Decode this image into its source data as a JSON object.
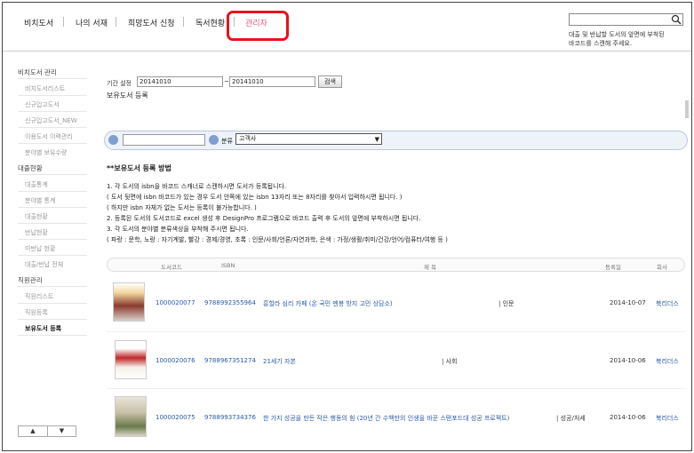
{
  "nav": {
    "items": [
      "비치도서",
      "나의 서재",
      "희망도서 신청",
      "독서현황",
      "관리자"
    ]
  },
  "search": {
    "placeholder": "",
    "help_line1": "대출 및 반납할 도서의 앞면에 부착된",
    "help_line2": "바코드를 스캔해 주세요."
  },
  "sidebar": {
    "group1": "비치도서 관리",
    "group1_items": [
      "비치도서리스트",
      "신규입고도서",
      "신규입고도서_NEW",
      "이용도서 이력관리",
      "분야별 보유수량"
    ],
    "group2": "대출현황",
    "group2_items": [
      "대출통계",
      "분야별 통계",
      "대출현황",
      "반납현황",
      "미반납 현황",
      "대출/반납 전체"
    ],
    "group3": "직원관리",
    "group3_items": [
      "직원리스트",
      "직원등록"
    ],
    "active_item": "보유도서 등록",
    "up": "▲",
    "down": "▼"
  },
  "period": {
    "label": "기간 설정",
    "from": "20141010",
    "to": "20141010",
    "tilde": "~",
    "button": "검색"
  },
  "section_title": "보유도서 등록",
  "register": {
    "barcode_value": "",
    "genre_label": "분류",
    "genre_selected": "고객사"
  },
  "guide": {
    "title": "**보유도서 등록 방법",
    "lines": [
      "1. 각 도서의 isbn을 바코드 스캐너로 스캔하시면 도서가 등록됩니다.",
      "( 도서 뒷면에 isbn 바코드가 있는 경우 도서 안쪽에 있는 isbn 13자리 또는 8자리를 찾아서 입력하시면 됩니다. )",
      "( 하지만 isbn 자체가 없는 도서는 등록이 불가능합니다. )",
      "2. 등록된 도서의 도서코드로 excel 생성 후 DesignPro 프로그램으로 바코드 출력 후 도서의 앞면에 부착하시면 됩니다.",
      "3. 각 도서의 분야별 분류색상을 부착해 주시면 됩니다.",
      "( 파랑 : 문학, 노랑 : 자기계발, 빨강 : 경제/경영, 초록 : 인문/사회/언론/자연과학, 은색 : 가정/생활/취미/건강/언어/컴퓨터/여행 등 )"
    ]
  },
  "table": {
    "headers": [
      "도서코드",
      "ISBN",
      "제 목",
      "등록일",
      "회사"
    ],
    "rows": [
      {
        "code": "1000020077",
        "isbn": "9788992355964",
        "title": "흥할라 심리 카페 (온 국민 멘붕 방지 고민 상담소)",
        "category": "| 인문",
        "date": "2014-10-07",
        "company": "북리더스"
      },
      {
        "code": "1000020076",
        "isbn": "9788967351274",
        "title": "21세기 자본",
        "category": "| 사회",
        "date": "2014-10-06",
        "company": "북리더스"
      },
      {
        "code": "1000020075",
        "isbn": "9788993734376",
        "title": "한 가지 성공을 만든 작은 행동의 힘 (20년 간 수백만의 인생을 바꾼 스탠포드대 성공 프로젝트)",
        "category": "| 성공/처세",
        "date": "2014-10-06",
        "company": "북리더스"
      }
    ]
  },
  "colors": {
    "accent_link": "#2a5aa8",
    "admin_pink": "#e0607a",
    "highlight_red": "#e8111c"
  }
}
